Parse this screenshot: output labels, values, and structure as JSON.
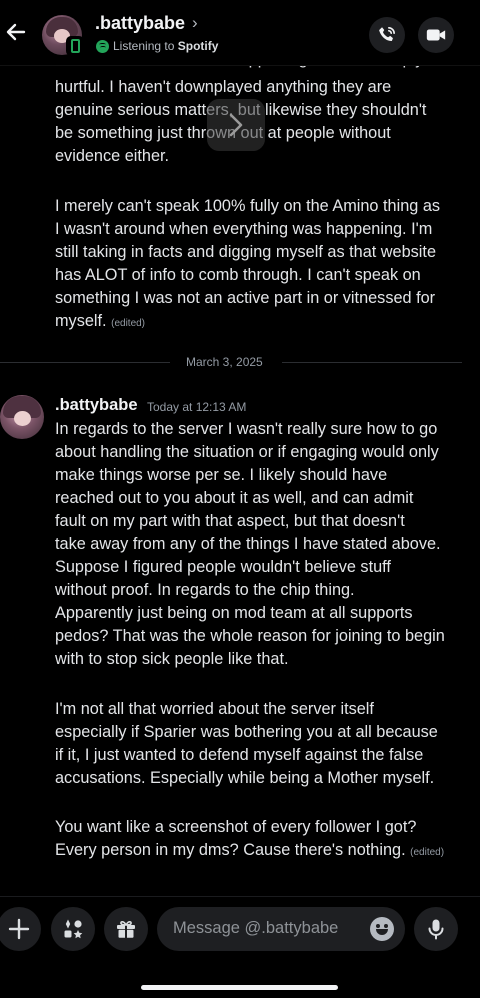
{
  "header": {
    "username": ".battybabe",
    "chevron": "›",
    "status_prefix": "Listening to",
    "status_app": "Spotify",
    "icons": {
      "back": "arrow-left-icon",
      "call": "phone-call-icon",
      "video": "video-camera-icon",
      "device": "mobile-phone-icon",
      "activity": "spotify-icon"
    }
  },
  "previous_message": {
    "cut_line": "claims with no evidence supporting it is also deeply",
    "text_1": "hurtful. I haven't downplayed anything they are\ngenuine serious matters, but likewise they shouldn't\nbe something just thrown out at people without\nevidence either.",
    "text_2": "I merely can't speak 100% fully on the Amino thing as\nI wasn't around when everything was happening. I'm\nstill taking in facts and digging myself as that website\nhas ALOT of info to comb through. I can't speak on\nsomething I was not an active part in or vitnessed for\nmyself.",
    "edited_label": "(edited)"
  },
  "date_divider": "March 3, 2025",
  "message": {
    "author": ".battybabe",
    "timestamp": "Today at 12:13 AM",
    "paragraph_1": "In regards to the server I wasn't really sure how to go\nabout handling the situation or if engaging would only\nmake things worse per se. I likely should have\nreached out to you about it as well, and can admit\nfault on my part with that aspect, but that doesn't\ntake away from any of the things I have stated above.\nSuppose I figured people wouldn't believe stuff\nwithout proof. In regards to the chip thing.\nApparently just being on mod team at all supports\npedos? That was the whole reason for joining to begin\nwith to stop sick people like that.",
    "paragraph_2": "I'm not all that worried about the server itself\nespecially if Sparier was bothering you at all because\nif it, I just wanted to defend myself against the false\naccusations. Especially while being a Mother myself.",
    "paragraph_3": "You want like a screenshot of every follower I got?\nEvery person in my dms? Cause there's nothing.",
    "edited_label": "(edited)"
  },
  "composer": {
    "placeholder": "Message @.battybabe",
    "icons": {
      "add": "plus-icon",
      "apps": "apps-icon",
      "gift": "gift-icon",
      "emoji": "emoji-icon",
      "mic": "microphone-icon"
    }
  },
  "colors": {
    "background": "#000000",
    "surface": "#1e1f22",
    "text": "#e3e5e8",
    "muted": "#949ba4",
    "online_green": "#23a55a"
  }
}
